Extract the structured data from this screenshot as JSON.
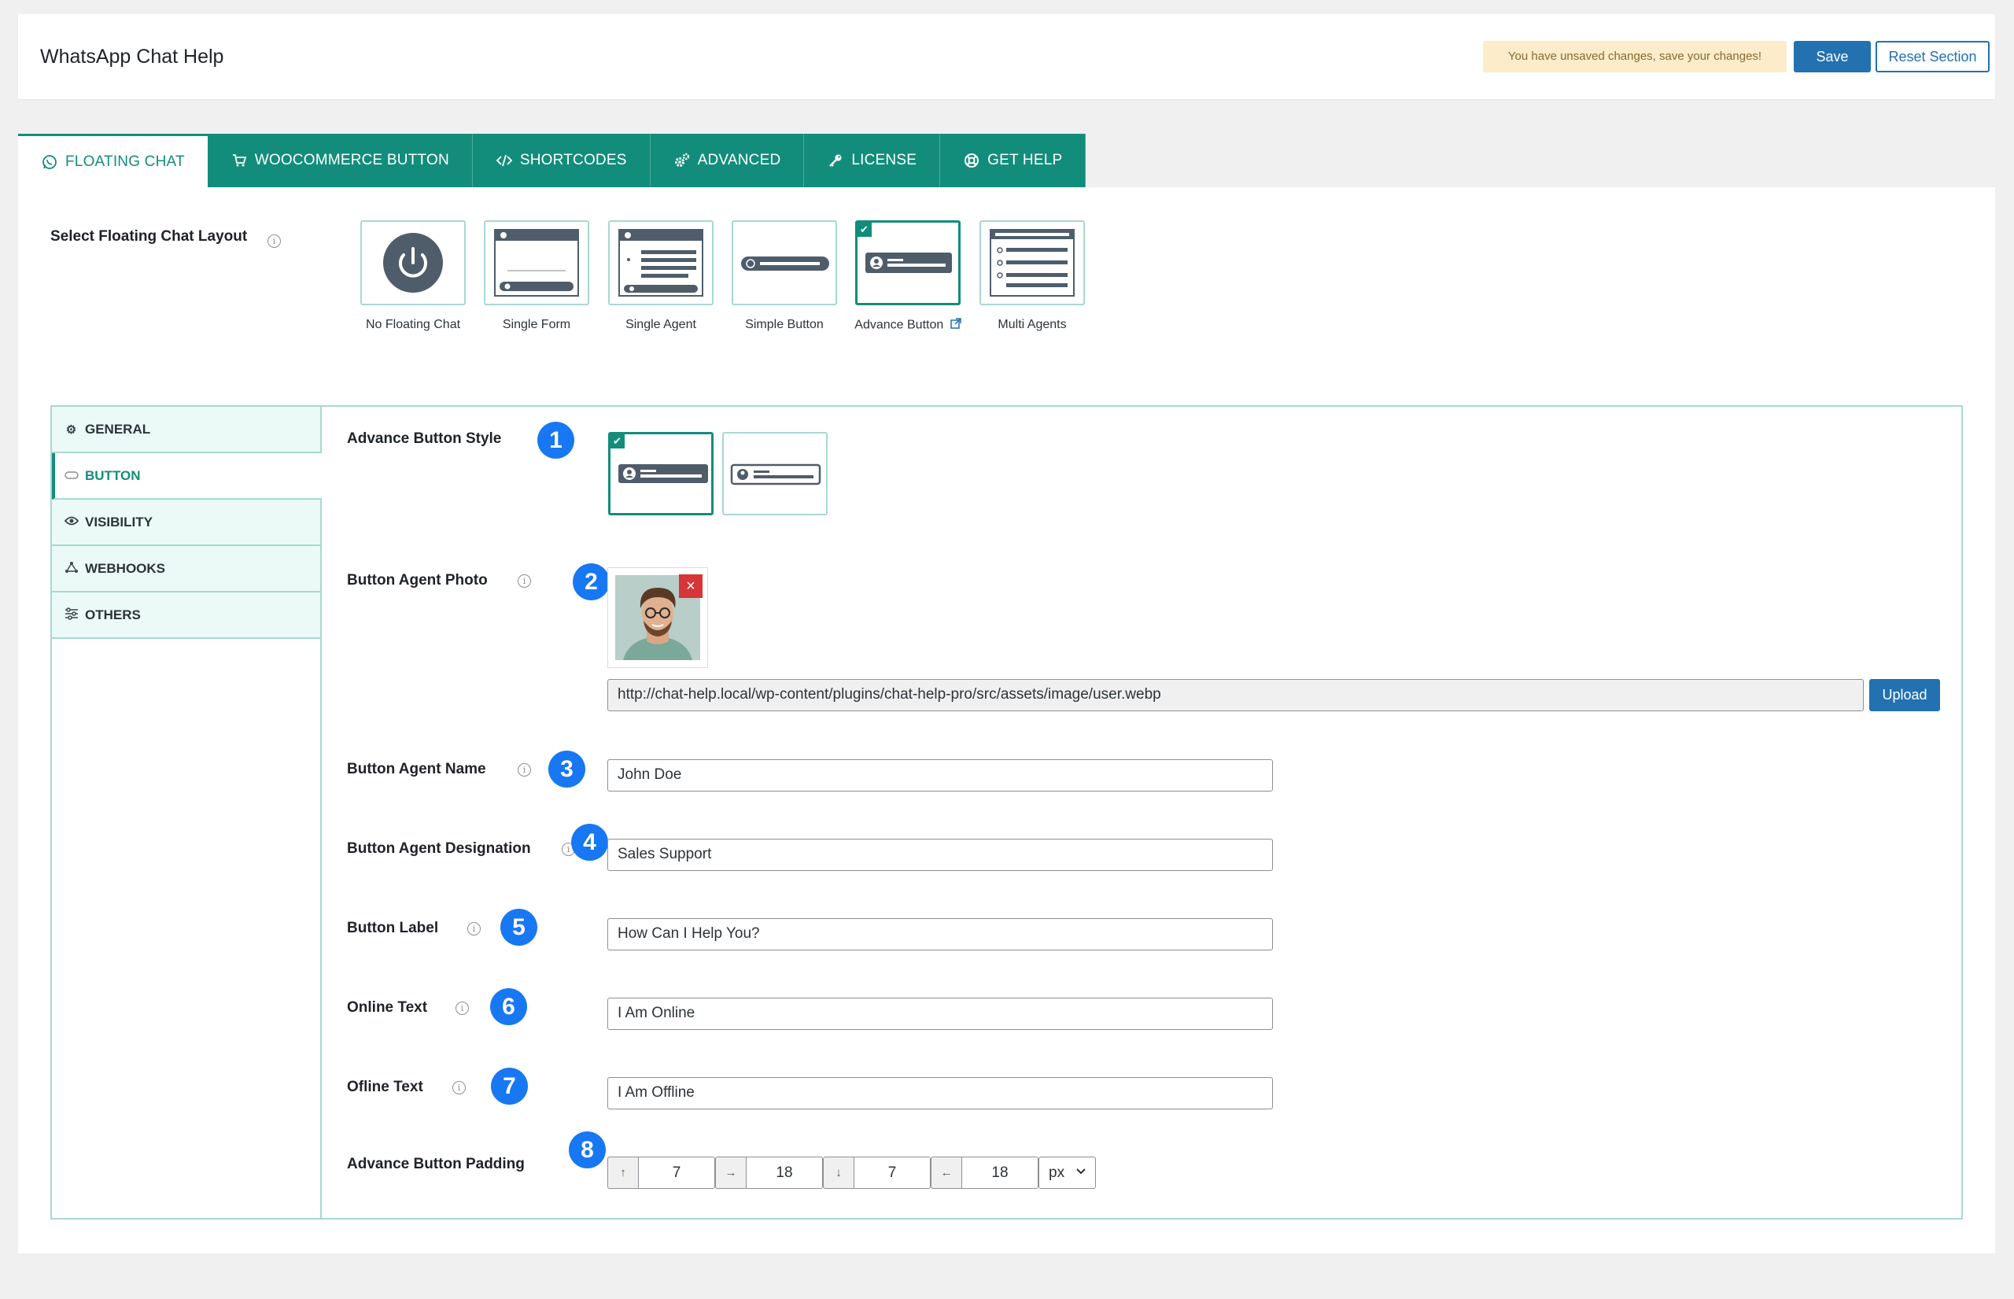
{
  "header": {
    "title": "WhatsApp Chat Help",
    "unsaved_notice": "You have unsaved changes, save your changes!",
    "save_label": "Save",
    "reset_label": "Reset Section"
  },
  "tabs": [
    {
      "label": "FLOATING CHAT",
      "icon": "whatsapp-icon",
      "active": true
    },
    {
      "label": "WOOCOMMERCE BUTTON",
      "icon": "cart-icon"
    },
    {
      "label": "SHORTCODES",
      "icon": "code-icon"
    },
    {
      "label": "ADVANCED",
      "icon": "gears-icon"
    },
    {
      "label": "LICENSE",
      "icon": "key-icon"
    },
    {
      "label": "GET HELP",
      "icon": "lifebuoy-icon"
    }
  ],
  "layout": {
    "label": "Select Floating Chat Layout",
    "options": [
      {
        "caption": "No Floating Chat"
      },
      {
        "caption": "Single Form"
      },
      {
        "caption": "Single Agent"
      },
      {
        "caption": "Simple Button"
      },
      {
        "caption": "Advance Button",
        "selected": true
      },
      {
        "caption": "Multi Agents"
      }
    ]
  },
  "sidebar": {
    "items": [
      {
        "label": "GENERAL",
        "icon": "gears-icon"
      },
      {
        "label": "BUTTON",
        "icon": "button-icon",
        "active": true
      },
      {
        "label": "VISIBILITY",
        "icon": "eye-icon"
      },
      {
        "label": "WEBHOOKS",
        "icon": "webhook-icon"
      },
      {
        "label": "OTHERS",
        "icon": "sliders-icon"
      }
    ]
  },
  "fields": {
    "style": {
      "label": "Advance Button Style",
      "badge": "1"
    },
    "photo": {
      "label": "Button Agent Photo",
      "badge": "2",
      "url": "http://chat-help.local/wp-content/plugins/chat-help-pro/src/assets/image/user.webp",
      "upload_label": "Upload",
      "remove_label": "×"
    },
    "name": {
      "label": "Button Agent Name",
      "badge": "3",
      "value": "John Doe"
    },
    "designation": {
      "label": "Button Agent Designation",
      "badge": "4",
      "value": "Sales Support"
    },
    "button_label": {
      "label": "Button Label",
      "badge": "5",
      "value": "How Can I Help You?"
    },
    "online": {
      "label": "Online Text",
      "badge": "6",
      "value": "I Am Online"
    },
    "offline": {
      "label": "Ofline Text",
      "badge": "7",
      "value": "I Am Offline"
    },
    "padding": {
      "label": "Advance Button Padding",
      "badge": "8",
      "top": "7",
      "right": "18",
      "bottom": "7",
      "left": "18",
      "unit": "px",
      "arrows": {
        "top": "↑",
        "right": "→",
        "bottom": "↓",
        "left": "←"
      }
    }
  },
  "colors": {
    "accent": "#138d7b",
    "primary": "#2271b1",
    "badge": "#1877f2"
  }
}
